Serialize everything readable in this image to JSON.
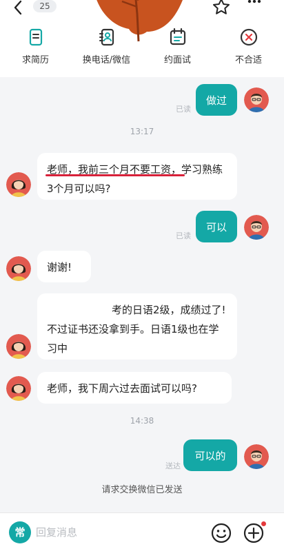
{
  "header": {
    "unread_count": "25",
    "actions": [
      {
        "label": "求简历",
        "icon": "resume-icon"
      },
      {
        "label": "换电话/微信",
        "icon": "exchange-contact-icon"
      },
      {
        "label": "约面试",
        "icon": "calendar-icon"
      },
      {
        "label": "不合适",
        "icon": "close-circle-icon"
      }
    ]
  },
  "chat": {
    "messages": [
      {
        "side": "out",
        "text": "做过",
        "status": "已读"
      },
      {
        "side": "time",
        "text": "13:17"
      },
      {
        "side": "in",
        "text": "老师，我前三个月不要工资，学习熟练3个月可以吗?"
      },
      {
        "side": "out",
        "text": "可以",
        "status": "已读"
      },
      {
        "side": "in",
        "text": "谢谢!"
      },
      {
        "side": "in",
        "text": "考的日语2级，成绩过了! 不过证书还没拿到手。日语1级也在学习中"
      },
      {
        "side": "in",
        "text": "老师，我下周六过去面试可以吗?"
      },
      {
        "side": "time",
        "text": "14:38"
      },
      {
        "side": "out",
        "text": "可以的",
        "status": "送达"
      },
      {
        "side": "system",
        "text": "请求交换微信已发送"
      }
    ]
  },
  "input": {
    "quick_label": "常",
    "placeholder": "回复消息"
  },
  "colors": {
    "accent": "#14a8a6",
    "highlight_underline": "#d8213a",
    "badge_dot": "#e4393c",
    "background": "#f4f5f7"
  }
}
